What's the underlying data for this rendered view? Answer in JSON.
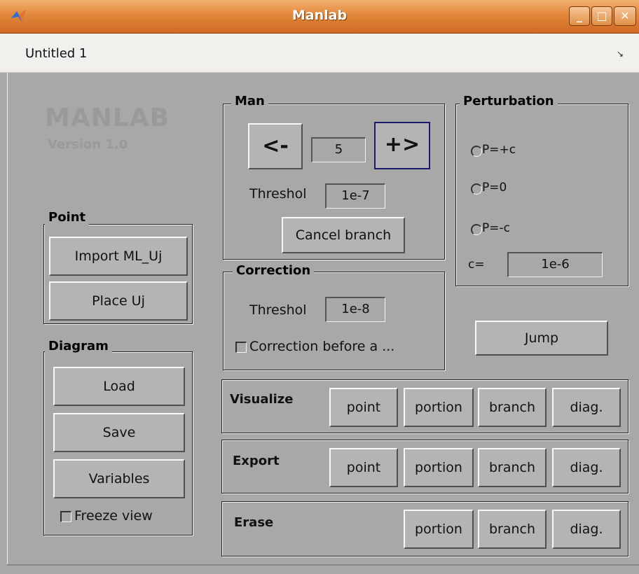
{
  "window": {
    "title": "Manlab",
    "minimize": "_",
    "maximize": "□",
    "close": "✕"
  },
  "menu": {
    "document_title": "Untitled 1"
  },
  "logo": {
    "name": "MANLAB",
    "version": "Version 1.0"
  },
  "point_panel": {
    "title": "Point",
    "import_label": "Import ML_Uj",
    "place_label": "Place Uj"
  },
  "diagram_panel": {
    "title": "Diagram",
    "load_label": "Load",
    "save_label": "Save",
    "variables_label": "Variables",
    "freeze_label": "Freeze view"
  },
  "man_panel": {
    "title": "Man",
    "prev_label": "<-",
    "next_label": "+>",
    "step_value": "5",
    "threshold_label": "Threshol",
    "threshold_value": "1e-7",
    "cancel_label": "Cancel branch"
  },
  "correction_panel": {
    "title": "Correction",
    "threshold_label": "Threshol",
    "threshold_value": "1e-8",
    "checkbox_label": "Correction before a ..."
  },
  "perturbation_panel": {
    "title": "Perturbation",
    "options": [
      "P=+c",
      "P=0",
      "P=-c"
    ],
    "c_label": "c=",
    "c_value": "1e-6"
  },
  "jump_label": "Jump",
  "visualize_panel": {
    "title": "Visualize",
    "buttons": [
      "point",
      "portion",
      "branch",
      "diag."
    ]
  },
  "export_panel": {
    "title": "Export",
    "buttons": [
      "point",
      "portion",
      "branch",
      "diag."
    ]
  },
  "erase_panel": {
    "title": "Erase",
    "buttons": [
      "portion",
      "branch",
      "diag."
    ]
  }
}
